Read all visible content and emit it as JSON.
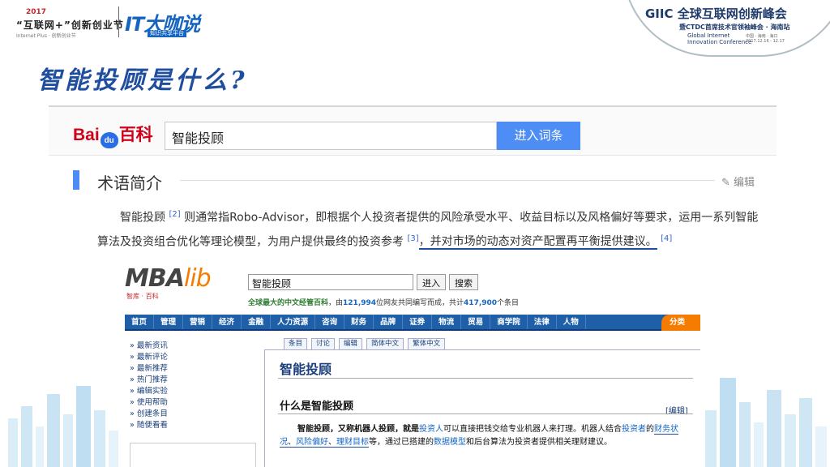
{
  "header": {
    "logo_year": "2017",
    "logo_name": "“互联网+”创新创业节",
    "logo_sub": "Internet Plus · 创新创业节",
    "it_logo": "IT大咖说",
    "it_sub": "知识共享平台",
    "giic_title": "GIIC 全球互联网创新峰会",
    "giic_sub": "暨CTDC首席技术官领袖峰会 · 海南站",
    "giic_en_1": "Global Internet",
    "giic_en_2": "Innovation Conference",
    "giic_date_1": "中国 · 海南 · 海口",
    "giic_date_2": "2017.12.16 - 12.17"
  },
  "slide_title": "智能投顾是什么?",
  "baidu": {
    "logo_bai": "Bai",
    "logo_du": "du",
    "logo_baike": "百科",
    "search_value": "智能投顾",
    "search_button": "进入词条",
    "section_heading": "术语简介",
    "edit_label": "编辑",
    "body_part1": "智能投顾",
    "ref2": "[2]",
    "body_part2": " 则通常指Robo-Advisor，即根据个人投资者提供的风险承受水平、收益目标以及风格偏好等要求，运用一系列智能算法及投资组合优化等理论模型，为用户提供最终的投资参考",
    "ref3": "[3]",
    "body_part3": "，并对市场的动态对资产配置再平衡提供建议。",
    "ref4": "[4]"
  },
  "mba": {
    "logo_mba": "MBA",
    "logo_lib": "lib",
    "logo_sub": "智库 · 百科",
    "search_value": "智能投顾",
    "go_button": "进入",
    "search_button": "搜索",
    "tag_prefix": "全球最大的中文经管百科",
    "tag_mid1": "，由",
    "tag_users": "121,994",
    "tag_mid2": "位网友共同编写而成，共计",
    "tag_entries": "417,900",
    "tag_suffix": "个条目",
    "nav": [
      "首页",
      "管理",
      "营销",
      "经济",
      "金融",
      "人力资源",
      "咨询",
      "财务",
      "品牌",
      "证券",
      "物流",
      "贸易",
      "商学院",
      "法律",
      "人物"
    ],
    "nav_more": "分类",
    "sidebar": [
      "» 最新资讯",
      "» 最新评论",
      "» 最新推荐",
      "» 热门推荐",
      "» 编辑实验",
      "» 使用帮助",
      "» 创建条目",
      "» 随便看看"
    ],
    "tabs": [
      "条目",
      "讨论",
      "编辑",
      "简体中文",
      "繁体中文"
    ],
    "page_title": "智能投顾",
    "section_heading": "什么是智能投顾",
    "edit_label": "[编辑]",
    "body_1": "智能投顾，又称机器人投顾，就是",
    "body_lk1": "投资人",
    "body_2": "可以直接把钱交给专业机器人来打理。机器人结合",
    "body_lk2": "投资者",
    "body_3": "的",
    "body_lk3": "财务状况",
    "body_4": "、",
    "body_lk4": "风险偏好",
    "body_5": "、",
    "body_lk5": "理财目标",
    "body_6": "等，通过已搭建的",
    "body_lk6": "数据模型",
    "body_7": "和后台算法为投资者提供相关理财建议。"
  }
}
